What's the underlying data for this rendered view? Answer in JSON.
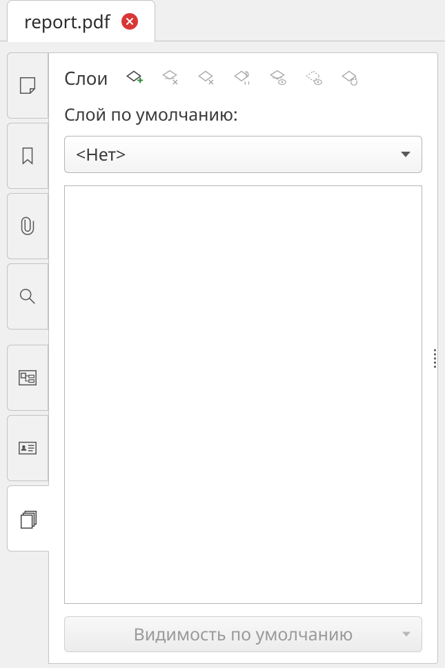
{
  "tab": {
    "title": "report.pdf",
    "closeIcon": "close-icon"
  },
  "sideTabs": [
    {
      "name": "annotations-tab",
      "icon": "sticky-note-icon",
      "active": false
    },
    {
      "name": "bookmarks-tab",
      "icon": "bookmark-icon",
      "active": false
    },
    {
      "name": "attachments-tab",
      "icon": "paperclip-icon",
      "active": false
    },
    {
      "name": "search-tab",
      "icon": "search-icon",
      "active": false
    },
    {
      "name": "model-tree-tab",
      "icon": "model-tree-icon",
      "active": false
    },
    {
      "name": "security-tab",
      "icon": "id-card-icon",
      "active": false
    },
    {
      "name": "layers-tab",
      "icon": "layers-icon",
      "active": true
    }
  ],
  "layersPanel": {
    "title": "Слои",
    "tools": [
      {
        "name": "add-layer",
        "icon": "rhombus-plus-icon",
        "enabled": true
      },
      {
        "name": "delete-layer",
        "icon": "rhombus-x-icon",
        "enabled": false
      },
      {
        "name": "delete-sublayer",
        "icon": "rhombus-sub-x-icon",
        "enabled": false
      },
      {
        "name": "rename-layer",
        "icon": "rhombus-text-icon",
        "enabled": false
      },
      {
        "name": "layer-visibility",
        "icon": "rhombus-eye-icon",
        "enabled": false
      },
      {
        "name": "layer-visibility2",
        "icon": "rhombus-dash-eye-icon",
        "enabled": false
      },
      {
        "name": "reset-layer",
        "icon": "rhombus-reset-icon",
        "enabled": false
      }
    ],
    "defaultLayerLabel": "Слой по умолчанию:",
    "defaultLayerValue": "<Нет>",
    "visibilityDropdownLabel": "Видимость по умолчанию"
  }
}
